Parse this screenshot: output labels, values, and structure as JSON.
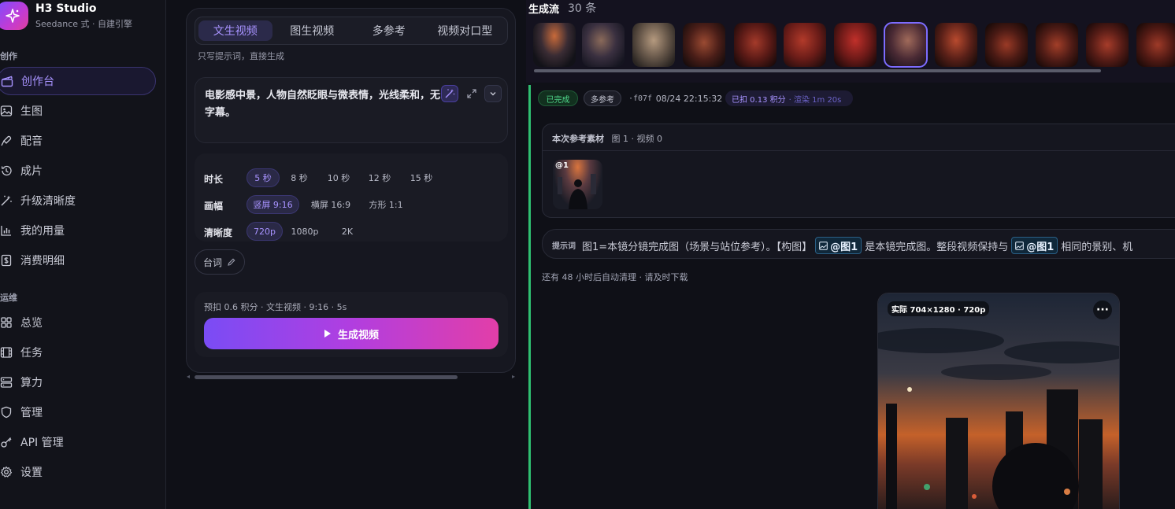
{
  "brand": {
    "name": "H3 Studio",
    "subtitle": "Seedance 式 · 自建引擎"
  },
  "sidebar": {
    "section_create": "创作",
    "section_ops": "运维",
    "create_items": [
      {
        "label": "创作台",
        "icon": "clapper-icon",
        "active": true
      },
      {
        "label": "生图",
        "icon": "image-icon"
      },
      {
        "label": "配音",
        "icon": "mic-icon"
      },
      {
        "label": "成片",
        "icon": "history-icon"
      },
      {
        "label": "升级清晰度",
        "icon": "wand-icon"
      },
      {
        "label": "我的用量",
        "icon": "bar-chart-icon"
      },
      {
        "label": "消费明细",
        "icon": "receipt-icon"
      }
    ],
    "ops_items": [
      {
        "label": "总览",
        "icon": "grid-icon"
      },
      {
        "label": "任务",
        "icon": "film-icon"
      },
      {
        "label": "算力",
        "icon": "server-icon"
      },
      {
        "label": "管理",
        "icon": "shield-icon"
      },
      {
        "label": "API 管理",
        "icon": "key-icon"
      },
      {
        "label": "设置",
        "icon": "gear-icon"
      }
    ]
  },
  "composer": {
    "tabs": [
      "文生视频",
      "图生视频",
      "多参考",
      "视频对口型"
    ],
    "active_tab": 0,
    "hint": "只写提示词，直接生成",
    "prompt_line1": "电影感中景，人物自然眨眼与微表情，光线柔和，无",
    "prompt_line2": "字幕。",
    "duration_label": "时长",
    "durations": [
      "5 秒",
      "8 秒",
      "10 秒",
      "12 秒",
      "15 秒"
    ],
    "ratio_label": "画幅",
    "ratios": [
      "竖屏 9:16",
      "横屏 16:9",
      "方形 1:1"
    ],
    "quality_label": "清晰度",
    "qualities": [
      "720p",
      "1080p",
      "2K"
    ],
    "lines_label": "台词",
    "estimate": "预扣 0.6 积分 · 文生视频 · 9:16 · 5s",
    "generate_label": "生成视频"
  },
  "flow": {
    "title": "生成流",
    "count": "30 条",
    "job": {
      "status": "已完成",
      "mode": "多参考",
      "id": "·f07f",
      "time": "08/24 22:15:32",
      "charge": "已扣 0.13 积分",
      "render": "· 渲染 1m 20s",
      "ref_title": "本次参考素材",
      "ref_counts": "图 1 · 视频 0",
      "ref_tag": "@1",
      "prompt_label": "提示词",
      "prompt_part1": "图1=本镜分镜完成图（场景与站位参考）。【构图】",
      "prompt_chip": "@图1",
      "prompt_part2": "是本镜完成图。整段视频保持与",
      "prompt_chip2": "@图1",
      "prompt_part3": "相同的景别、机",
      "cleanup": "还有 48 小时后自动清理 · 请及时下载",
      "video_tag": "实际 704×1280 · 720p",
      "video_more": "···"
    }
  },
  "colors": {
    "accent": "#a893ff",
    "success": "#2fbf71",
    "gradient_start": "#7a4cf5",
    "gradient_end": "#e23ea8"
  }
}
